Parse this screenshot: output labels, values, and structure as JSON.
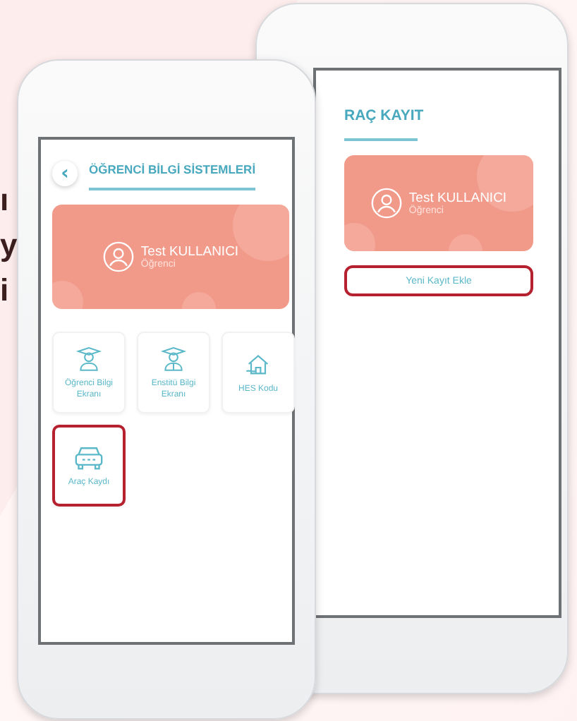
{
  "side_text": [
    "ı",
    "y",
    "i"
  ],
  "back_phone": {
    "title": "RAÇ KAYIT",
    "profile": {
      "name": "Test KULLANICI",
      "role": "Öğrenci"
    },
    "button": {
      "label": "Yeni Kayıt Ekle",
      "highlighted": true
    }
  },
  "front_phone": {
    "back": "‹",
    "title": "ÖĞRENCİ BİLGİ SİSTEMLERİ",
    "profile": {
      "name": "Test KULLANICI",
      "role": "Öğrenci"
    },
    "tiles": [
      {
        "kind": "student",
        "label": "Öğrenci Bilgi Ekranı",
        "highlighted": false
      },
      {
        "kind": "graduate",
        "label": "Enstitü Bilgi Ekranı",
        "highlighted": false
      },
      {
        "kind": "house",
        "label": "HES Kodu",
        "highlighted": false
      },
      {
        "kind": "car",
        "label": "Araç Kaydı",
        "highlighted": true
      }
    ]
  }
}
